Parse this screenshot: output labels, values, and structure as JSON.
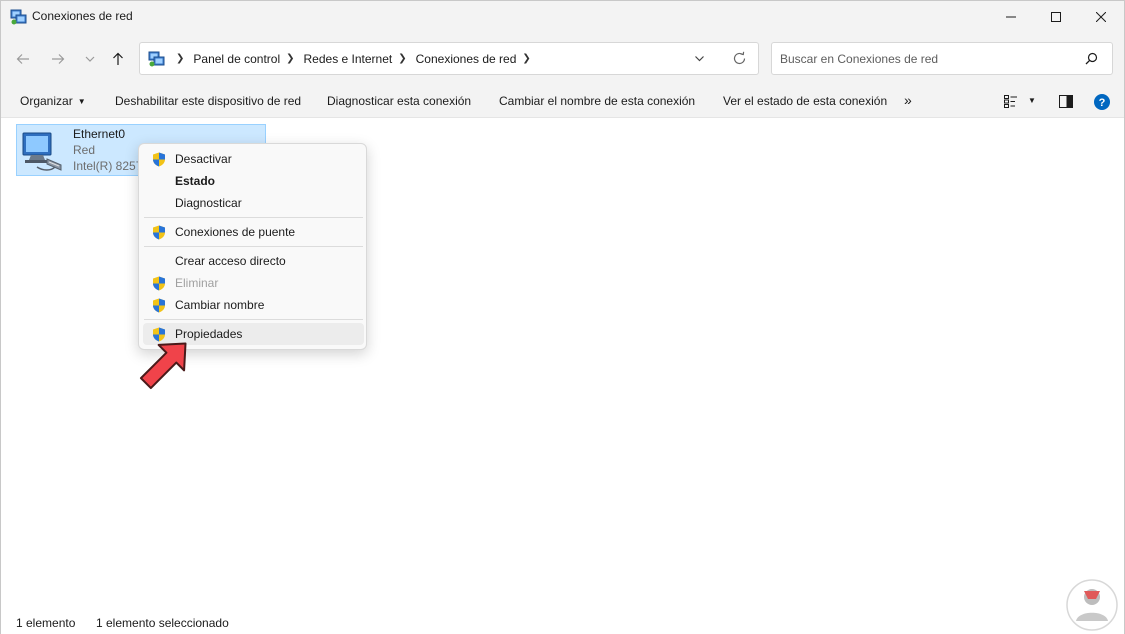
{
  "window": {
    "title": "Conexiones de red"
  },
  "nav": {
    "breadcrumbs": [
      "Panel de control",
      "Redes e Internet",
      "Conexiones de red"
    ],
    "search_placeholder": "Buscar en Conexiones de red"
  },
  "cmdbar": {
    "organize": "Organizar",
    "disable": "Deshabilitar este dispositivo de red",
    "diagnose": "Diagnosticar esta conexión",
    "rename": "Cambiar el nombre de esta conexión",
    "status": "Ver el estado de esta conexión",
    "more": "»"
  },
  "item": {
    "name": "Ethernet0",
    "status": "Red",
    "device": "Intel(R) 8257"
  },
  "menu": {
    "items": [
      {
        "label": "Desactivar",
        "shield": true
      },
      {
        "label": "Estado",
        "bold": true
      },
      {
        "label": "Diagnosticar"
      },
      {
        "label": "Conexiones de puente",
        "shield": true
      },
      {
        "label": "Crear acceso directo"
      },
      {
        "label": "Eliminar",
        "shield": true,
        "disabled": true
      },
      {
        "label": "Cambiar nombre",
        "shield": true
      },
      {
        "label": "Propiedades",
        "shield": true,
        "highlighted": true
      }
    ]
  },
  "statusbar": {
    "count": "1 elemento",
    "selected": "1 elemento seleccionado"
  },
  "colors": {
    "selection_bg": "#cce8ff",
    "selection_border": "#99d1ff",
    "arrow_red": "#f0434a",
    "help_blue": "#0067c0"
  }
}
